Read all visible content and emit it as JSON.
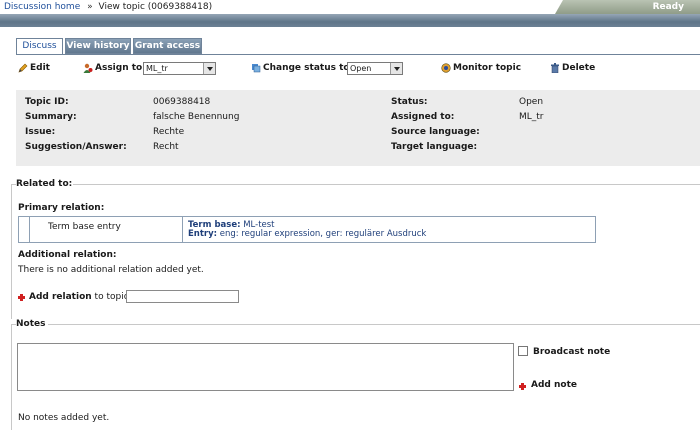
{
  "breadcrumb": {
    "home": "Discussion home",
    "separator": "»",
    "current": "View topic (0069388418)"
  },
  "status_indicator": "Ready",
  "tabs": [
    {
      "label": "Discuss",
      "active": true
    },
    {
      "label": "View history",
      "active": false
    },
    {
      "label": "Grant access",
      "active": false
    }
  ],
  "toolbar": {
    "edit_label": "Edit",
    "assign_label": "Assign to:",
    "assign_value": "ML_tr",
    "change_status_label": "Change status to:",
    "change_status_value": "Open",
    "monitor_label": "Monitor topic",
    "delete_label": "Delete"
  },
  "topic": {
    "id_label": "Topic ID:",
    "id_value": "0069388418",
    "summary_label": "Summary:",
    "summary_value": "falsche Benennung",
    "issue_label": "Issue:",
    "issue_value": "Rechte",
    "suggestion_label": "Suggestion/Answer:",
    "suggestion_value": "Recht",
    "status_label": "Status:",
    "status_value": "Open",
    "assigned_label": "Assigned to:",
    "assigned_value": "ML_tr",
    "source_lang_label": "Source language:",
    "source_lang_value": "",
    "target_lang_label": "Target language:",
    "target_lang_value": ""
  },
  "related": {
    "title": "Related to:",
    "primary_title": "Primary relation:",
    "primary_type": "Term base entry",
    "termbase_label": "Term base:",
    "termbase_value": "ML-test",
    "entry_label": "Entry:",
    "entry_value": "eng: regular expression, ger: regulärer Ausdruck",
    "additional_title": "Additional relation:",
    "additional_empty": "There is no additional relation added yet.",
    "add_relation_bold": "Add relation",
    "add_relation_rest": "to topic:",
    "add_relation_input": ""
  },
  "notes": {
    "title": "Notes",
    "note_text": "",
    "broadcast_label": "Broadcast note",
    "add_note_label": "Add note",
    "empty": "No notes added yet."
  },
  "colors": {
    "band": "#6c8094",
    "tab_inactive": "#60778e",
    "info_bg": "#ececec",
    "link": "#1f3f7a",
    "add_icon": "#d02020"
  },
  "icons": {
    "edit": "pencil-icon",
    "assign": "user-icon",
    "change_status": "status-change-icon",
    "monitor": "monitor-icon",
    "delete": "trash-icon",
    "add": "plus-icon"
  }
}
